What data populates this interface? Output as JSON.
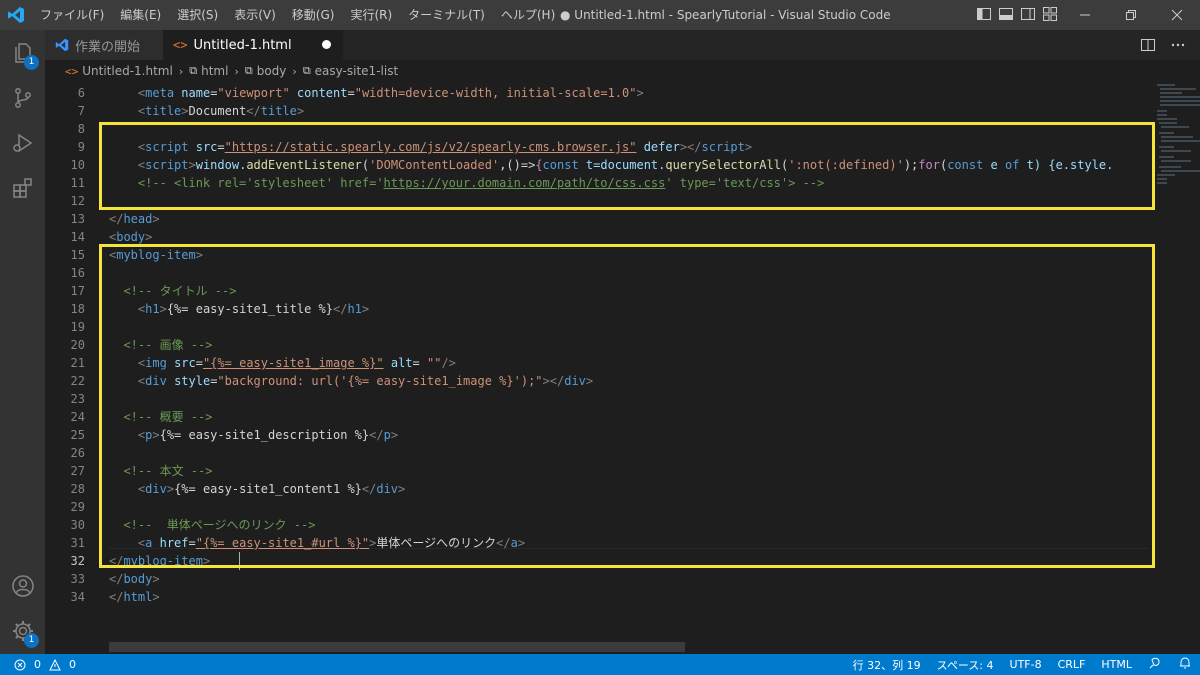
{
  "window": {
    "title": "● Untitled-1.html - SpearlyTutorial - Visual Studio Code",
    "menu": [
      "ファイル(F)",
      "編集(E)",
      "選択(S)",
      "表示(V)",
      "移動(G)",
      "実行(R)",
      "ターミナル(T)",
      "ヘルプ(H)"
    ]
  },
  "activity": {
    "explorer_badge": "1",
    "manage_badge": "1"
  },
  "tabs": [
    {
      "label": "作業の開始",
      "icon": "vscode-icon"
    },
    {
      "label": "Untitled-1.html",
      "icon": "html-icon",
      "dirty": true
    }
  ],
  "breadcrumb": [
    "Untitled-1.html",
    "html",
    "body",
    "easy-site1-list"
  ],
  "editor": {
    "line_numbers": [
      "6",
      "7",
      "8",
      "9",
      "10",
      "11",
      "12",
      "13",
      "14",
      "15",
      "16",
      "17",
      "18",
      "19",
      "20",
      "21",
      "22",
      "23",
      "24",
      "25",
      "26",
      "27",
      "28",
      "29",
      "30",
      "31",
      "32",
      "33",
      "34"
    ],
    "active_line": "32",
    "lines": {
      "l6": {
        "attr1": "name",
        "val1": "\"viewport\"",
        "attr2": "content",
        "val2": "\"width=device-width, initial-scale=1.0\""
      },
      "l7": {
        "text": "Document"
      },
      "l9": {
        "attr1": "src",
        "val1": "\"https://static.spearly.com/js/v2/spearly-cms.browser.js\"",
        "attr2": "defer"
      },
      "l10": {
        "p1": "window.",
        "p2": "addEventListener",
        "p3": "(",
        "p4": "'DOMContentLoaded'",
        "p5": ",()=>",
        "p6": "{",
        "p7": "const",
        "p8": " t=",
        "p9": "document.",
        "p10": "querySelectorAll",
        "p11": "(",
        "p12": "':not(:defined)'",
        "p13": ");",
        "p14": "for",
        "p15": "(",
        "p16": "const",
        "p17": " e ",
        "p18": "of",
        "p19": " t) {e.style."
      },
      "l11": {
        "text": "<!-- <link rel='stylesheet' href='",
        "url": "https://your.domain.com/path/to/css.css",
        "tail": "' type='text/css'> -->"
      },
      "l17": {
        "comment": "<!-- タイトル -->"
      },
      "l18": {
        "text": "{%= easy-site1_title %}"
      },
      "l20": {
        "comment": "<!-- 画像 -->"
      },
      "l21": {
        "attr1": "src",
        "val1": "\"{%= easy-site1_image %}\"",
        "attr2": "alt",
        "val2": "\"\""
      },
      "l22": {
        "attr1": "style",
        "val1": "\"background: url('{%= easy-site1_image %}');\""
      },
      "l24": {
        "comment": "<!-- 概要 -->"
      },
      "l25": {
        "text": "{%= easy-site1_description %}"
      },
      "l27": {
        "comment": "<!-- 本文 -->"
      },
      "l28": {
        "text": "{%= easy-site1_content1 %}"
      },
      "l30": {
        "comment": "<!--  単体ページへのリンク -->"
      },
      "l31": {
        "attr1": "href",
        "val1": "\"{%= easy-site1_#url %}\"",
        "text": "単体ページへのリンク"
      }
    },
    "tags": {
      "meta": "meta",
      "title": "title",
      "script": "script",
      "head": "head",
      "body": "body",
      "item": "myblog-item",
      "h1": "h1",
      "img": "img",
      "div": "div",
      "p": "p",
      "a": "a",
      "html": "html"
    }
  },
  "status": {
    "errors": "0",
    "warnings": "0",
    "position": "行 32、列 19",
    "indent": "スペース: 4",
    "encoding": "UTF-8",
    "eol": "CRLF",
    "language": "HTML"
  },
  "colors": {
    "accent": "#007acc",
    "highlight_box": "#f5e43a"
  }
}
